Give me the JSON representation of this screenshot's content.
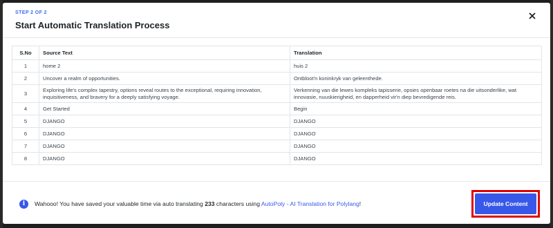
{
  "modal": {
    "step_label": "STEP 2 OF 2",
    "title": "Start Automatic Translation Process",
    "close_glyph": "✕"
  },
  "table": {
    "headers": [
      "S.No",
      "Source Text",
      "Translation"
    ],
    "rows": [
      {
        "sno": "1",
        "source": "home 2",
        "translation": "huis 2"
      },
      {
        "sno": "2",
        "source": "Uncover a realm of opportunities.",
        "translation": "Ontbloot'n koninkryk van geleenthede."
      },
      {
        "sno": "3",
        "source": "Exploring life's complex tapestry, options reveal routes to the exceptional, requiring innovation, inquisitiveness, and bravery for a deeply satisfying voyage.",
        "translation": "Verkenning van die lewes kompleks tapisserie, opsies openbaar roetes na die uitsonderlike, wat innovasie, nuuskierigheid, en dapperheid vir'n diep bevredigende reis."
      },
      {
        "sno": "4",
        "source": "Get Started",
        "translation": "Begin"
      },
      {
        "sno": "5",
        "source": "DJANGO",
        "translation": "DJANGO"
      },
      {
        "sno": "6",
        "source": "DJANGO",
        "translation": "DJANGO"
      },
      {
        "sno": "7",
        "source": "DJANGO",
        "translation": "DJANGO"
      },
      {
        "sno": "8",
        "source": "DJANGO",
        "translation": "DJANGO"
      }
    ]
  },
  "footer": {
    "info_icon_glyph": "i",
    "message_prefix": "Wahooo! You have saved your valuable time via auto translating ",
    "char_count": "233",
    "message_middle": " characters using ",
    "link_text": "AutoPoly - AI Translation for Polylang",
    "message_suffix": "!",
    "button_label": "Update Content"
  },
  "colors": {
    "accent": "#3858e9",
    "highlight": "#e00000",
    "backdrop": "#1e1e1e"
  }
}
